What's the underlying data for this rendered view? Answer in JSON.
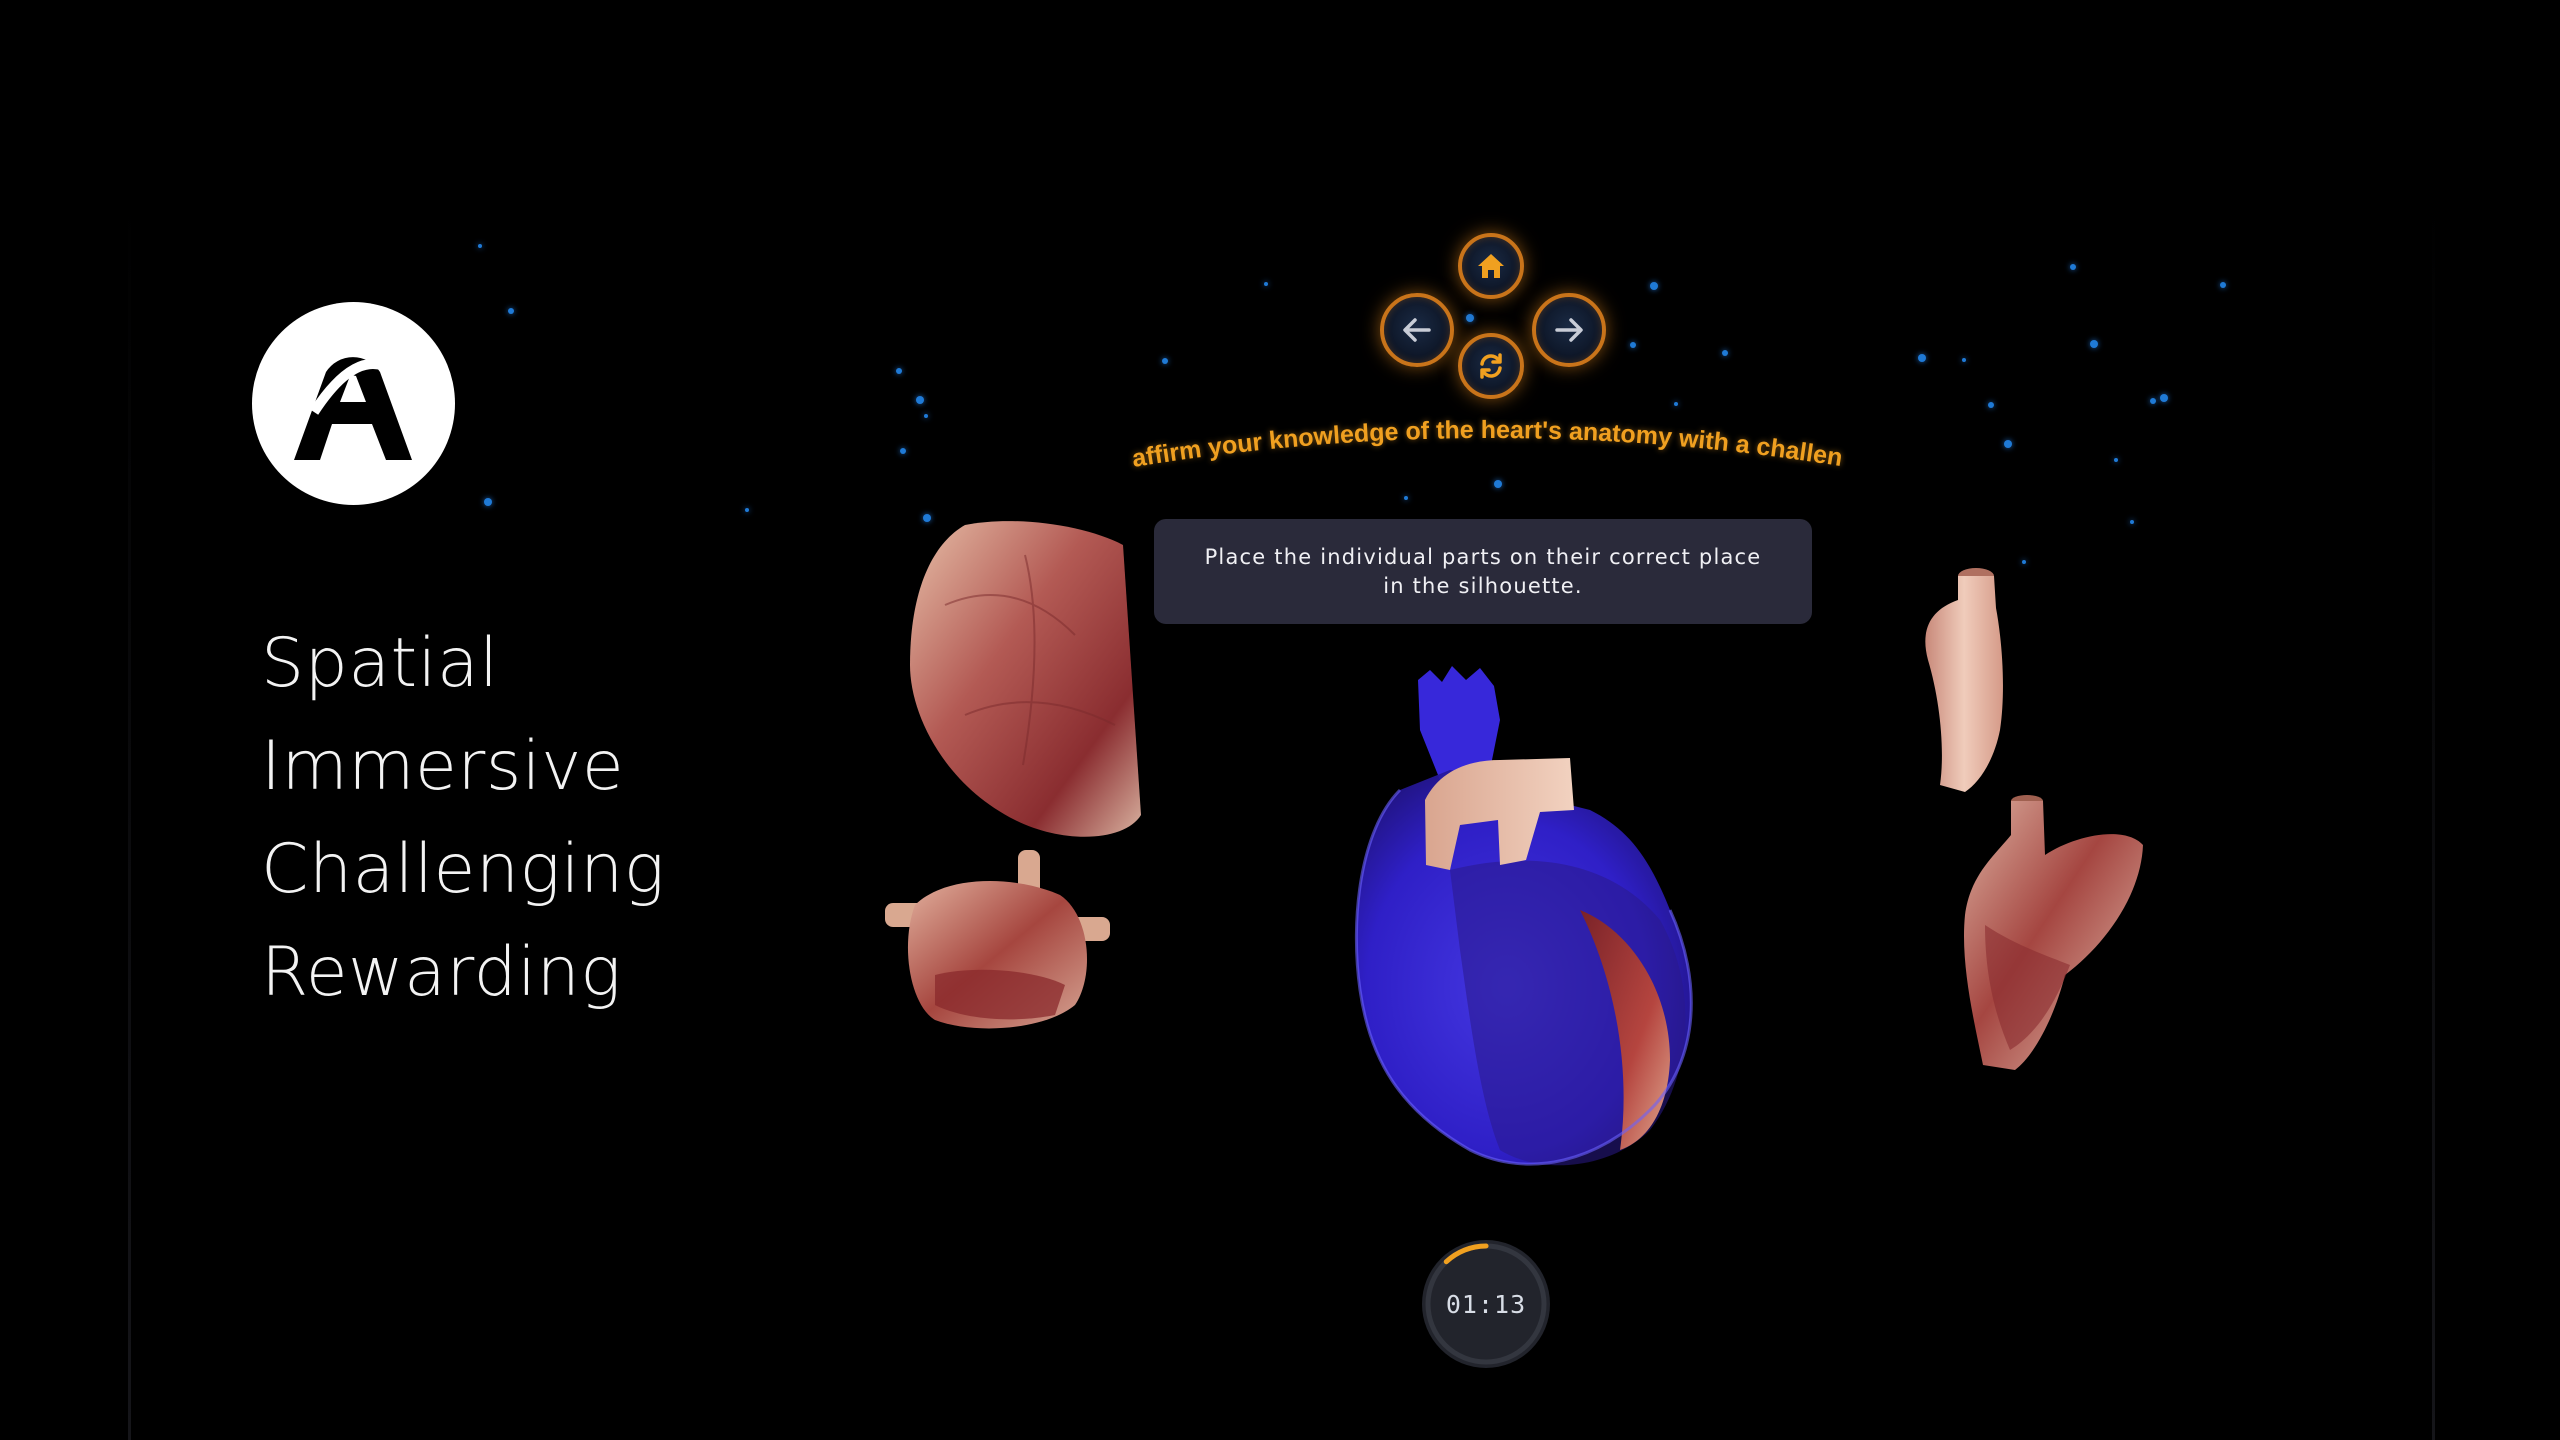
{
  "brand": {
    "logo_letter": "A"
  },
  "tagline": [
    "Spatial",
    "Immersive",
    "Challenging",
    "Rewarding"
  ],
  "nav": {
    "home_icon": "home-icon",
    "back_icon": "arrow-left-icon",
    "forward_icon": "arrow-right-icon",
    "reset_icon": "refresh-icon",
    "accent_color": "#f0a020"
  },
  "challenge": {
    "headline": "Reaffirm your knowledge of the heart's anatomy with a challenge!",
    "instruction": "Place the individual parts on their correct place in the silhouette."
  },
  "timer": {
    "time": "01:13",
    "progress": 0.12
  },
  "pieces": [
    "left-ventricle-piece",
    "atria-piece",
    "aortic-arch-piece",
    "right-side-piece"
  ],
  "colors": {
    "background": "#000000",
    "silhouette": "#3a2be0",
    "tissue": "#b5453f",
    "card": "#2a2a3a"
  }
}
